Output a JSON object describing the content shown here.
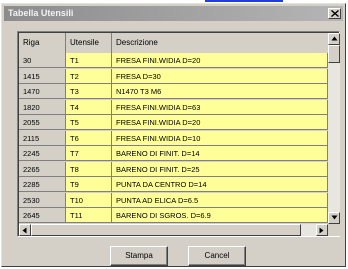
{
  "window": {
    "title": "Tabella Utensili"
  },
  "table": {
    "headers": [
      "Riga",
      "Utensile",
      "Descrizione"
    ],
    "rows": [
      {
        "riga": "30",
        "utensile": "T1",
        "descrizione": "FRESA FINI.WIDIA D=20"
      },
      {
        "riga": "1415",
        "utensile": "T2",
        "descrizione": "FRESA D=30"
      },
      {
        "riga": "1470",
        "utensile": "T3",
        "descrizione": "N1470 T3 M6"
      },
      {
        "riga": "1820",
        "utensile": "T4",
        "descrizione": "FRESA FINI.WIDIA D=63"
      },
      {
        "riga": "2055",
        "utensile": "T5",
        "descrizione": "FRESA FINI.WIDIA D=20"
      },
      {
        "riga": "2115",
        "utensile": "T6",
        "descrizione": "FRESA FINI.WIDIA D=10"
      },
      {
        "riga": "2245",
        "utensile": "T7",
        "descrizione": "BARENO DI FINIT. D=14"
      },
      {
        "riga": "2265",
        "utensile": "T8",
        "descrizione": "BARENO DI FINIT. D=25"
      },
      {
        "riga": "2285",
        "utensile": "T9",
        "descrizione": "PUNTA DA CENTRO D=14"
      },
      {
        "riga": "2530",
        "utensile": "T10",
        "descrizione": "PUNTA AD ELICA D=6.5"
      },
      {
        "riga": "2645",
        "utensile": "T11",
        "descrizione": "BARENO DI SGROS. D=6.9"
      }
    ]
  },
  "buttons": {
    "print": "Stampa",
    "cancel": "Cancel"
  },
  "colors": {
    "cell_highlight": "#ffff99",
    "dialog_face": "#d4d0c8"
  }
}
